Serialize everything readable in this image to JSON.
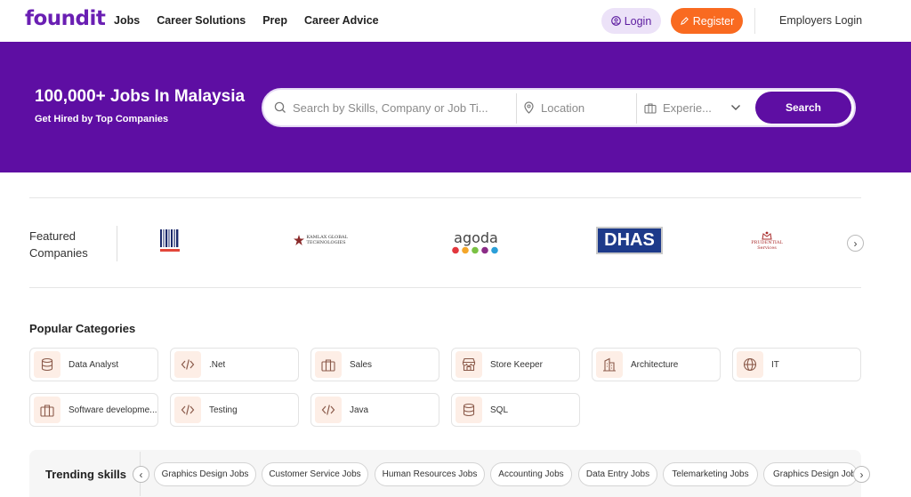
{
  "header": {
    "logo": "foundit",
    "nav": [
      "Jobs",
      "Career Solutions",
      "Prep",
      "Career Advice"
    ],
    "login_label": "Login",
    "register_label": "Register",
    "employers_login": "Employers Login"
  },
  "hero": {
    "title": "100,000+ Jobs In Malaysia",
    "subtitle": "Get Hired by Top Companies",
    "search": {
      "skills_placeholder": "Search by Skills, Company or Job Ti...",
      "location_placeholder": "Location",
      "experience_placeholder": "Experie...",
      "button": "Search"
    }
  },
  "featured": {
    "label_line1": "Featured",
    "label_line2": "Companies",
    "companies": [
      {
        "name": "Bar Code",
        "logo_text": "BarCode"
      },
      {
        "name": "Kamlax Global Technologies",
        "logo_text": "KAMLAX GLOBAL TECHNOLOGIES"
      },
      {
        "name": "agoda",
        "logo_text": "agoda"
      },
      {
        "name": "DHAS",
        "logo_text": "DHAS"
      },
      {
        "name": "Prudential Services",
        "logo_text": "PRUDENTIAL Services"
      }
    ]
  },
  "categories": {
    "title": "Popular Categories",
    "items": [
      {
        "label": "Data Analyst",
        "icon": "database-icon"
      },
      {
        "label": ".Net",
        "icon": "code-icon"
      },
      {
        "label": "Sales",
        "icon": "briefcase-icon"
      },
      {
        "label": "Store Keeper",
        "icon": "store-icon"
      },
      {
        "label": "Architecture",
        "icon": "building-icon"
      },
      {
        "label": "IT",
        "icon": "globe-icon"
      },
      {
        "label": "Software developme...",
        "icon": "briefcase-icon"
      },
      {
        "label": "Testing",
        "icon": "code-icon"
      },
      {
        "label": "Java",
        "icon": "code-icon"
      },
      {
        "label": "SQL",
        "icon": "database-icon"
      }
    ]
  },
  "trending": {
    "label": "Trending skills",
    "chips": [
      "Graphics Design Jobs",
      "Customer Service Jobs",
      "Human Resources Jobs",
      "Accounting Jobs",
      "Data Entry Jobs",
      "Telemarketing Jobs",
      "Graphics Design Jobs"
    ]
  },
  "colors": {
    "brand": "#5e0ea3",
    "accent": "#f96a20"
  }
}
